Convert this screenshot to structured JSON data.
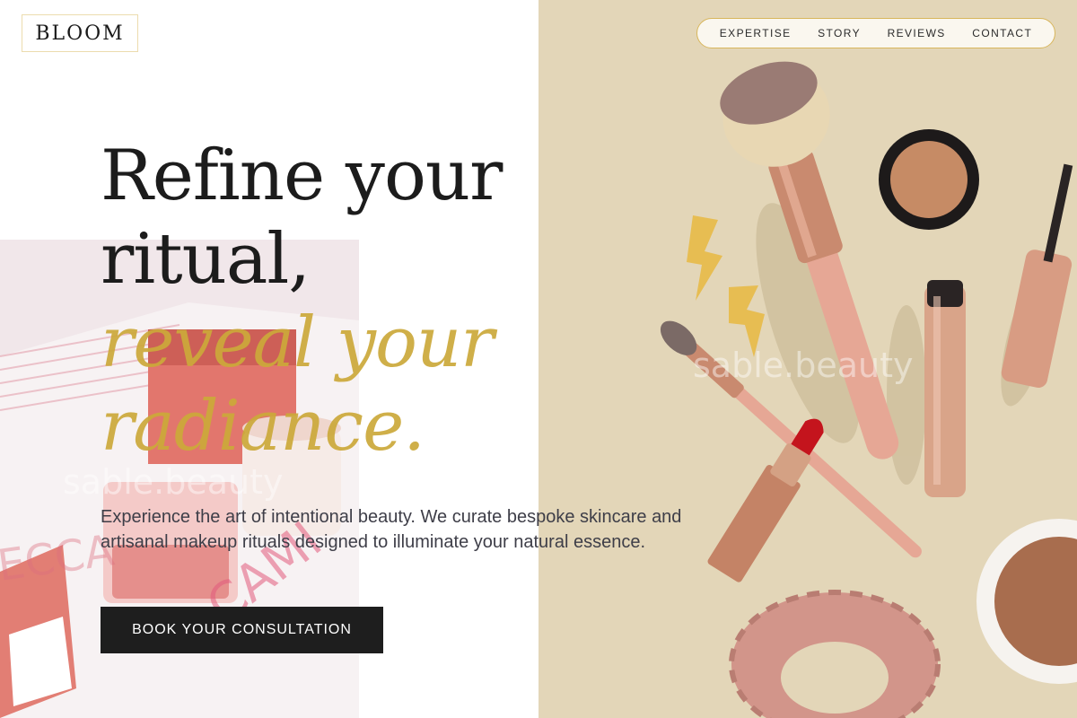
{
  "brand": {
    "logo_text": "BLOOM"
  },
  "nav": {
    "items": [
      {
        "label": "EXPERTISE"
      },
      {
        "label": "STORY"
      },
      {
        "label": "REVIEWS"
      },
      {
        "label": "CONTACT"
      }
    ]
  },
  "hero": {
    "headline_line1": "Refine your",
    "headline_line2": "ritual,",
    "headline_accent1": "reveal your",
    "headline_accent2": "radiance.",
    "subtext": "Experience the art of intentional beauty. We curate bespoke skincare and artisanal makeup rituals designed to illuminate your natural essence.",
    "cta_label": "BOOK YOUR CONSULTATION"
  },
  "watermarks": {
    "text": "sable.beauty"
  },
  "colors": {
    "accent_gold": "#cca93a",
    "beige_background": "#e3d6b8",
    "cta_background": "#1e1e1e",
    "nav_border": "#d8b65c"
  }
}
